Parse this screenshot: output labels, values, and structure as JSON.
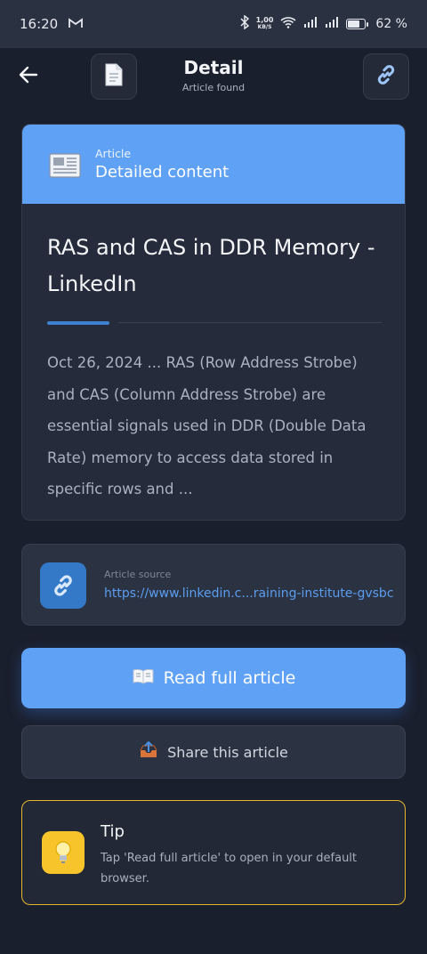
{
  "status_bar": {
    "time": "16:20",
    "app_icon": "gmail-m-icon",
    "net_speed_value": "1,00",
    "net_speed_unit": "KB/S",
    "battery": "62 %",
    "battery_level": 0.62
  },
  "header": {
    "title": "Detail",
    "subtitle": "Article found",
    "back_icon": "back-arrow-icon",
    "doc_icon": "document-icon",
    "link_icon": "link-icon"
  },
  "article": {
    "kind_label": "Article",
    "section_label": "Detailed content",
    "title": "RAS and CAS in DDR Memory - LinkedIn",
    "snippet": "Oct 26, 2024 ... RAS (Row Address Strobe) and CAS (Column Address Strobe) are essential signals used in DDR (Double Data Rate) memory to access data stored in specific rows and ..."
  },
  "source": {
    "label": "Article source",
    "url": "https://www.linkedin.c...raining-institute-gvsbc"
  },
  "actions": {
    "read_label": "Read full article",
    "share_label": "Share this article"
  },
  "tip": {
    "title": "Tip",
    "text": "Tap 'Read full article' to open in your default browser."
  },
  "colors": {
    "accent": "#5fa1f5",
    "background": "#1a1f2d",
    "tip_border": "#e3b62e"
  }
}
